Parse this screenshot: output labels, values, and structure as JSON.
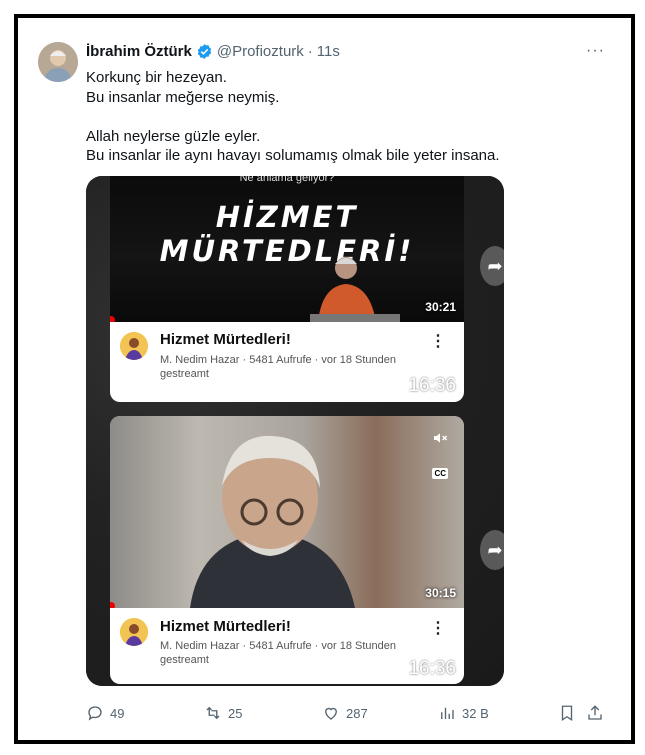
{
  "tweet": {
    "author_name": "İbrahim Öztürk",
    "handle": "@Profiozturk",
    "separator": "·",
    "time": "11s",
    "more_label": "···",
    "text_lines": [
      "Korkunç bir hezeyan.",
      "Bu insanlar meğerse neymiş.",
      "",
      "Allah neylerse güzle eyler.",
      "Bu insanlar ile aynı havayı solumamış olmak bile yeter insana."
    ]
  },
  "media": {
    "card1": {
      "banner_subtitle": "Ne anlama geliyor?",
      "banner_title": "HİZMET MÜRTEDLERİ!",
      "thumb_duration": "30:21",
      "title": "Hizmet Mürtedleri!",
      "meta": "M. Nedim  Hazar · 5481 Aufrufe · vor 18 Stunden gestreamt",
      "menu": "⋮",
      "time": "16:36"
    },
    "card2": {
      "thumb_duration": "30:15",
      "cc_label": "CC",
      "title": "Hizmet Mürtedleri!",
      "meta": "M. Nedim  Hazar · 5481 Aufrufe · vor 18 Stunden gestreamt",
      "menu": "⋮",
      "time": "16:36"
    }
  },
  "actions": {
    "replies": "49",
    "retweets": "25",
    "likes": "287",
    "views": "32 B"
  },
  "colors": {
    "muted": "#536471",
    "verified": "#1d9bf0",
    "progress": "#e00000"
  }
}
